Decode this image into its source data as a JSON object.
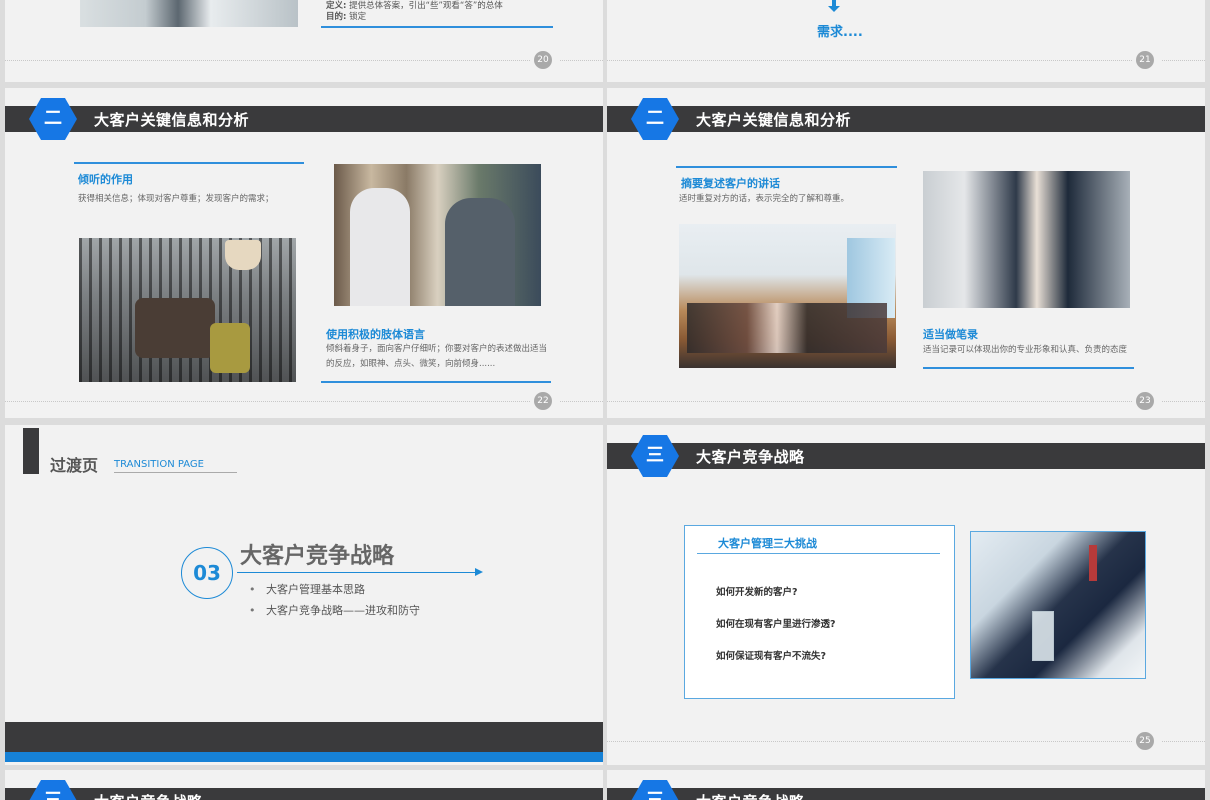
{
  "slide20": {
    "def_label": "定义:",
    "def_text": "提供总体答案，引出“些”观看“答”的总体",
    "purpose_label": "目的:",
    "purpose_text": "锁定",
    "page": "20"
  },
  "slide21": {
    "need_text": "需求....",
    "page": "21"
  },
  "slide22": {
    "hex_num": "二",
    "bar_title": "大客户关键信息和分析",
    "listen_title": "倾听的作用",
    "listen_text": "获得相关信息；体现对客户尊重；发现客户的需求；",
    "body_title": "使用积极的肢体语言",
    "body_text": "倾斜着身子，面向客户仔细听；你要对客户的表述做出适当的反应，如眼神、点头、微笑，向前倾身......",
    "page": "22"
  },
  "slide23": {
    "hex_num": "二",
    "bar_title": "大客户关键信息和分析",
    "summary_title": "摘要复述客户的讲话",
    "summary_text": "适时重复对方的话，表示完全的了解和尊重。",
    "note_title": "适当做笔录",
    "note_text": "适当记录可以体现出你的专业形象和认真、负责的态度",
    "page": "23"
  },
  "slide24": {
    "trans_title": "过渡页",
    "trans_en": "TRANSITION PAGE",
    "chap_num": "03",
    "chap_title": "大客户竞争战略",
    "bullets": [
      "大客户管理基本思路",
      "大客户竞争战略——进攻和防守"
    ]
  },
  "slide25": {
    "hex_num": "三",
    "bar_title": "大客户竞争战略",
    "box_title": "大客户管理三大挑战",
    "questions": [
      "如何开发新的客户?",
      "如何在现有客户里进行渗透?",
      "如何保证现有客户不流失?"
    ],
    "page": "25"
  },
  "slide26": {
    "hex_num": "三",
    "bar_title": "大客户竞争战略"
  },
  "slide27": {
    "hex_num": "三",
    "bar_title": "大客户竞争战略"
  }
}
